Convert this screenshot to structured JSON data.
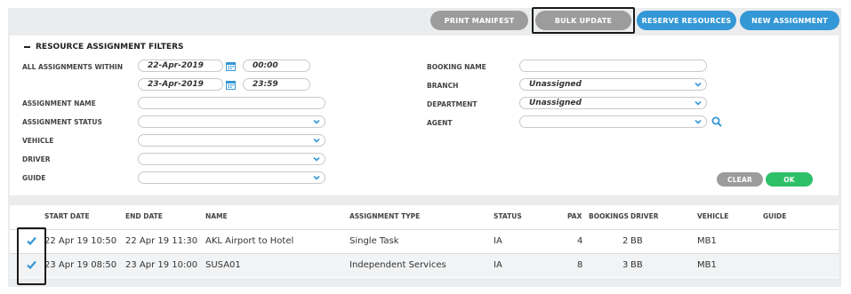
{
  "toolbar": {
    "print_manifest": "PRINT MANIFEST",
    "bulk_update": "BULK UPDATE",
    "reserve_resources": "RESERVE RESOURCES",
    "new_assignment": "NEW ASSIGNMENT"
  },
  "filters": {
    "title": "RESOURCE ASSIGNMENT FILTERS",
    "all_assignments_within_label": "ALL ASSIGNMENTS WITHIN",
    "date_from": "22-Apr-2019",
    "time_from": "00:00",
    "date_to": "23-Apr-2019",
    "time_to": "23:59",
    "assignment_name_label": "ASSIGNMENT NAME",
    "assignment_name_value": "",
    "assignment_status_label": "ASSIGNMENT STATUS",
    "assignment_status_value": "",
    "vehicle_label": "VEHICLE",
    "vehicle_value": "",
    "driver_label": "DRIVER",
    "driver_value": "",
    "guide_label": "GUIDE",
    "guide_value": "",
    "booking_name_label": "BOOKING NAME",
    "booking_name_value": "",
    "branch_label": "BRANCH",
    "branch_value": "Unassigned",
    "department_label": "DEPARTMENT",
    "department_value": "Unassigned",
    "agent_label": "AGENT",
    "agent_value": "",
    "clear": "CLEAR",
    "ok": "OK"
  },
  "table": {
    "headers": [
      "START DATE",
      "END DATE",
      "NAME",
      "ASSIGNMENT TYPE",
      "STATUS",
      "PAX",
      "BOOKINGS",
      "DRIVER",
      "VEHICLE",
      "GUIDE"
    ],
    "rows": [
      {
        "start": "22 Apr 19 10:50",
        "end": "22 Apr 19 11:30",
        "name": "AKL Airport to Hotel",
        "type": "Single Task",
        "status": "IA",
        "pax": "4",
        "bookings": "2",
        "driver": "BB",
        "vehicle": "MB1",
        "guide": "",
        "checked": true
      },
      {
        "start": "23 Apr 19 08:50",
        "end": "23 Apr 19 10:00",
        "name": "SUSA01",
        "type": "Independent Services",
        "status": "IA",
        "pax": "8",
        "bookings": "3",
        "driver": "BB",
        "vehicle": "MB1",
        "guide": "",
        "checked": true
      }
    ]
  },
  "icons": {
    "collapse": "minus-icon",
    "calendar": "calendar-icon",
    "dropdown": "chevron-down-icon",
    "search": "search-icon",
    "check": "checkmark-icon"
  },
  "colors": {
    "accent_blue": "#3497d6",
    "gray_button": "#9c9c9c",
    "ok_green": "#2ec069",
    "background": "#ebeced"
  }
}
